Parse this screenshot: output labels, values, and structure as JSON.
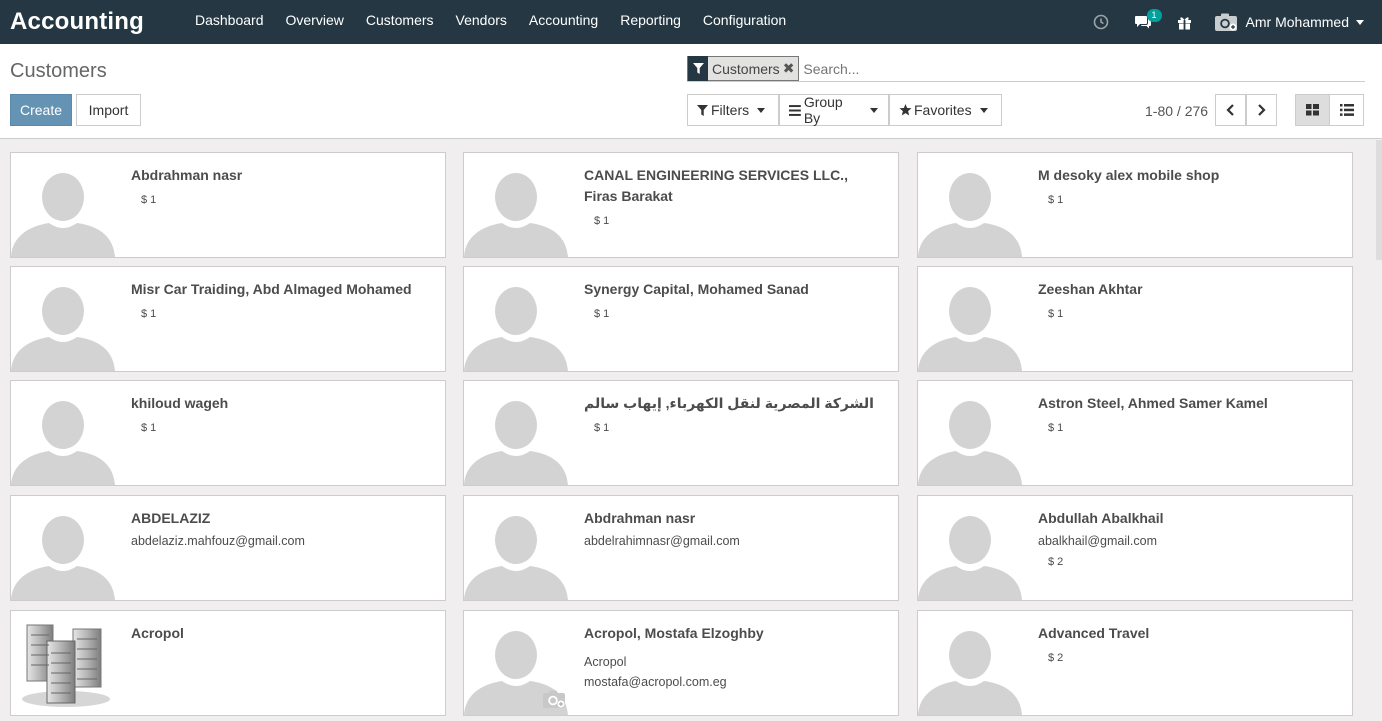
{
  "app": {
    "title": "Accounting"
  },
  "menu": [
    "Dashboard",
    "Overview",
    "Customers",
    "Vendors",
    "Accounting",
    "Reporting",
    "Configuration"
  ],
  "systray": {
    "messages_count": "1",
    "user_name": "Amr Mohammed"
  },
  "breadcrumb": "Customers",
  "buttons": {
    "create": "Create",
    "import": "Import"
  },
  "search": {
    "facet": "Customers",
    "placeholder": "Search..."
  },
  "dropdowns": {
    "filters": "Filters",
    "group_by": "Group By",
    "favorites": "Favorites"
  },
  "pager": {
    "value": "1-80 / 276"
  },
  "cards": [
    {
      "name": "Abdrahman nasr",
      "amount": "$ 1"
    },
    {
      "name": "CANAL ENGINEERING SERVICES LLC., Firas Barakat",
      "amount": "$ 1"
    },
    {
      "name": "M desoky alex mobile shop",
      "amount": "$ 1"
    },
    {
      "name": "Misr Car Traiding, Abd Almaged Mohamed",
      "amount": "$ 1"
    },
    {
      "name": "Synergy Capital, Mohamed Sanad",
      "amount": "$ 1"
    },
    {
      "name": "Zeeshan Akhtar",
      "amount": "$ 1"
    },
    {
      "name": "khiloud wageh",
      "amount": "$ 1"
    },
    {
      "name": "الشركة المصرية لنقل الكهرباء, إيهاب سالم",
      "amount": "$ 1"
    },
    {
      "name": "Astron Steel, Ahmed Samer Kamel",
      "amount": "$ 1"
    },
    {
      "name": "ABDELAZIZ",
      "email": "abdelaziz.mahfouz@gmail.com"
    },
    {
      "name": "Abdrahman nasr",
      "email": "abdelrahimnasr@gmail.com"
    },
    {
      "name": "Abdullah Abalkhail",
      "email": "abalkhail@gmail.com",
      "amount": "$ 2"
    },
    {
      "name": "Acropol",
      "image": "company-building"
    },
    {
      "name": "Acropol, Mostafa Elzoghby",
      "company": "Acropol",
      "email": "mostafa@acropol.com.eg"
    },
    {
      "name": "Advanced Travel",
      "amount": "$ 2"
    }
  ]
}
